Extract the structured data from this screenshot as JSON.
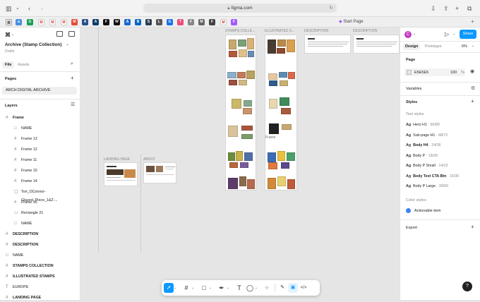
{
  "browser": {
    "url": "figma.com",
    "tab_title": "Start Page",
    "favicons": [
      "a",
      "G",
      "M",
      "M",
      "M",
      "M",
      "A",
      "A",
      "F",
      "W",
      "A",
      "B",
      "S",
      "L",
      "G",
      "T",
      "F",
      "M",
      "F"
    ]
  },
  "left_panel": {
    "file_name": "Archive (Stamp Collection)",
    "file_sub": "Drafts",
    "tab_file": "File",
    "tab_assets": "Assets",
    "pages_label": "Pages",
    "page_item": "ARCH DIGITAL ARCHIVE",
    "layers_label": "Layers",
    "layers": [
      {
        "icon": "#",
        "label": "Frame",
        "bold": true,
        "indent": 0
      },
      {
        "icon": "□",
        "label": "NAME",
        "bold": false,
        "indent": 1
      },
      {
        "icon": "#",
        "label": "Frame 13",
        "bold": false,
        "indent": 1
      },
      {
        "icon": "#",
        "label": "Frame 12",
        "bold": false,
        "indent": 1
      },
      {
        "icon": "#",
        "label": "Frame 11",
        "bold": false,
        "indent": 1
      },
      {
        "icon": "#",
        "label": "Frame 15",
        "bold": false,
        "indent": 1
      },
      {
        "icon": "#",
        "label": "Frame 14",
        "bold": false,
        "indent": 1
      },
      {
        "icon": "▢",
        "label": "Tori_OConnor-Glazed_Piece_1&2-...",
        "bold": false,
        "indent": 1
      },
      {
        "icon": "#",
        "label": "Frame 16",
        "bold": false,
        "indent": 1
      },
      {
        "icon": "▭",
        "label": "Rectangle 21",
        "bold": false,
        "indent": 1
      },
      {
        "icon": "□",
        "label": "NAME",
        "bold": false,
        "indent": 1
      },
      {
        "icon": "#",
        "label": "DESCRIPTION",
        "bold": true,
        "indent": 0
      },
      {
        "icon": "#",
        "label": "DESCRIPTION",
        "bold": true,
        "indent": 0
      },
      {
        "icon": "□",
        "label": "NAME",
        "bold": false,
        "indent": 0
      },
      {
        "icon": "#",
        "label": "STAMPS COLLECTION",
        "bold": true,
        "indent": 0
      },
      {
        "icon": "#",
        "label": "ILLUSTRATED STAMPS",
        "bold": true,
        "indent": 0
      },
      {
        "icon": "T",
        "label": "EUROPE",
        "bold": false,
        "indent": 0
      },
      {
        "icon": "#",
        "label": "LANDING PAGE",
        "bold": true,
        "indent": 0
      }
    ]
  },
  "canvas": {
    "frame_labels": {
      "stamps": "STAMPS COLLE...",
      "illustrated": "ILLUSTRATED S...",
      "desc1": "DESCRIPTION",
      "desc2": "DESCRIPTION",
      "landing": "LANDING PAGE",
      "about": "ABOUT",
      "frame": "Frame"
    }
  },
  "right_panel": {
    "avatar_letter": "C",
    "share_label": "Share",
    "tab_design": "Design",
    "tab_prototype": "Prototype",
    "zoom": "6%",
    "page_label": "Page",
    "page_color": "E5E5E5",
    "page_opacity": "100",
    "page_opacity_unit": "%",
    "variables_label": "Variables",
    "styles_label": "Styles",
    "text_styles_label": "Text styles",
    "text_styles": [
      {
        "name": "Hero H1",
        "spec": "56/80",
        "bold": false
      },
      {
        "name": "Sub-page H1",
        "spec": "48/72",
        "bold": false
      },
      {
        "name": "Body H4",
        "spec": "24/36",
        "bold": true
      },
      {
        "name": "Body P",
        "spec": "18/30",
        "bold": false
      },
      {
        "name": "Body P Small",
        "spec": "14/22",
        "bold": false
      },
      {
        "name": "Body Text CTA Btn",
        "spec": "16/30",
        "bold": true
      },
      {
        "name": "Body P Large",
        "spec": "36/50",
        "bold": false
      }
    ],
    "color_styles_label": "Color styles",
    "color_item": "Actionable item",
    "color_item_hex": "#3b82f6",
    "export_label": "Export",
    "help": "?"
  },
  "colors": {
    "accent": "#0d99ff",
    "brand": "#a259ff"
  }
}
